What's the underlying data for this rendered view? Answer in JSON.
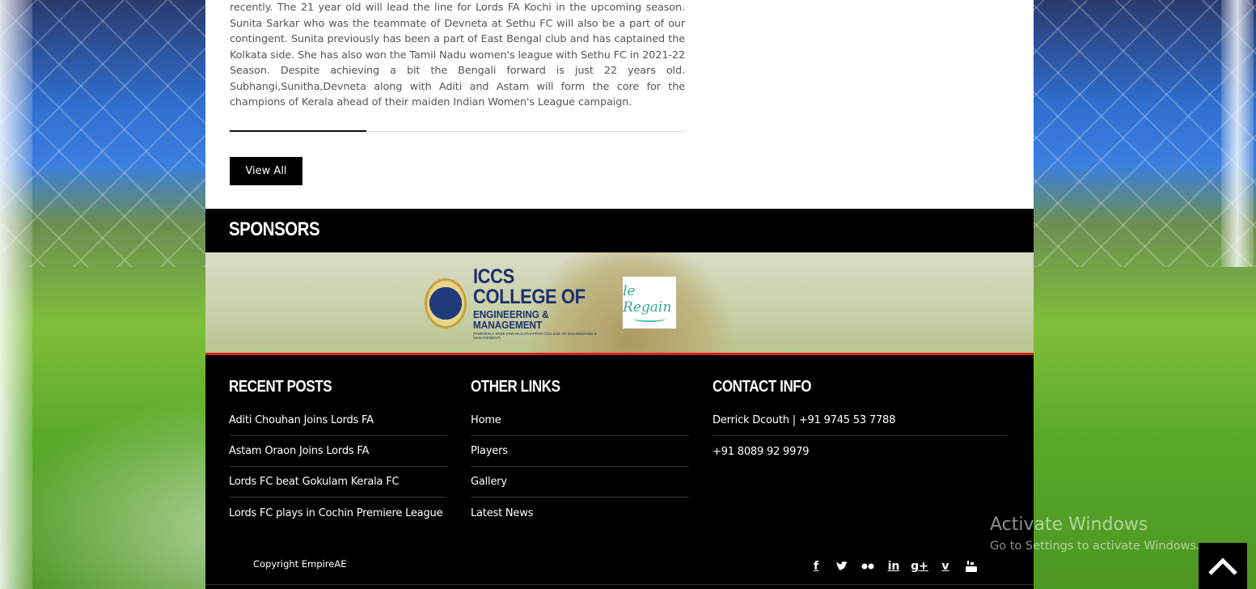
{
  "article": {
    "text": "recently. The 21 year old will lead the line for Lords FA Kochi in the upcoming season. Sunita Sarkar who was the teammate of Devneta at Sethu FC will also be a part of our contingent. Sunita previously has been a part of East Bengal club and has captained the Kolkata side. She has also won the Tamil Nadu women's league with Sethu FC in 2021-22 Season. Despite achieving a bit the Bengali forward is just 22 years old. Subhangi,Sunitha,Devneta along with Aditi and Astam will form the core for the champions of Kerala ahead of their maiden Indian Women's League campaign.",
    "view_all_label": "View All"
  },
  "sponsors": {
    "title": "SPONSORS",
    "logos": [
      {
        "name": "iccs-logo",
        "line1": "ICCS COLLEGE OF",
        "line2": "ENGINEERING & MANAGEMENT",
        "line3": "(FORMERLY SREE ERNAKULATHAPPAN COLLEGE OF ENGINEERING & MANAGEMENT)"
      },
      {
        "name": "regain-logo",
        "text": "le Regain"
      }
    ]
  },
  "footer": {
    "recent_posts": {
      "title": "RECENT POSTS",
      "items": [
        "Aditi Chouhan Joins Lords FA",
        "Astam Oraon Joins Lords FA",
        "Lords FC beat Gokulam Kerala FC",
        "Lords FC plays in Cochin Premiere League"
      ]
    },
    "other_links": {
      "title": "OTHER LINKS",
      "items": [
        "Home",
        "Players",
        "Gallery",
        "Latest News"
      ]
    },
    "contact_info": {
      "title": "CONTACT INFO",
      "items": [
        "Derrick Dcouth | +91 9745 53 7788",
        "+91 8089 92 9979"
      ]
    },
    "copyright": "Copyright EmpireAE",
    "social_icons": [
      "facebook-icon",
      "twitter-icon",
      "flickr-icon",
      "linkedin-icon",
      "google-plus-icon",
      "vimeo-icon",
      "youtube-icon"
    ]
  },
  "windows_watermark": {
    "line1": "Activate Windows",
    "line2": "Go to Settings to activate Windows."
  },
  "colors": {
    "accent_red": "#d81e1e",
    "footer_bg": "#000000"
  }
}
